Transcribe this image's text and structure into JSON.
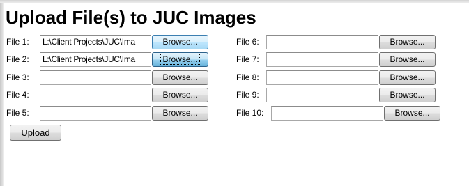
{
  "page": {
    "title": "Upload File(s) to JUC Images"
  },
  "files": [
    {
      "label": "File 1:",
      "value": "L:\\Client Projects\\JUC\\Ima",
      "browse_label": "Browse..."
    },
    {
      "label": "File 2:",
      "value": "L:\\Client Projects\\JUC\\Ima",
      "browse_label": "Browse..."
    },
    {
      "label": "File 3:",
      "value": "",
      "browse_label": "Browse..."
    },
    {
      "label": "File 4:",
      "value": "",
      "browse_label": "Browse..."
    },
    {
      "label": "File 5:",
      "value": "",
      "browse_label": "Browse..."
    },
    {
      "label": "File 6:",
      "value": "",
      "browse_label": "Browse..."
    },
    {
      "label": "File 7:",
      "value": "",
      "browse_label": "Browse..."
    },
    {
      "label": "File 8:",
      "value": "",
      "browse_label": "Browse..."
    },
    {
      "label": "File 9:",
      "value": "",
      "browse_label": "Browse..."
    },
    {
      "label": "File 10:",
      "value": "",
      "browse_label": "Browse..."
    }
  ],
  "upload": {
    "label": "Upload"
  }
}
